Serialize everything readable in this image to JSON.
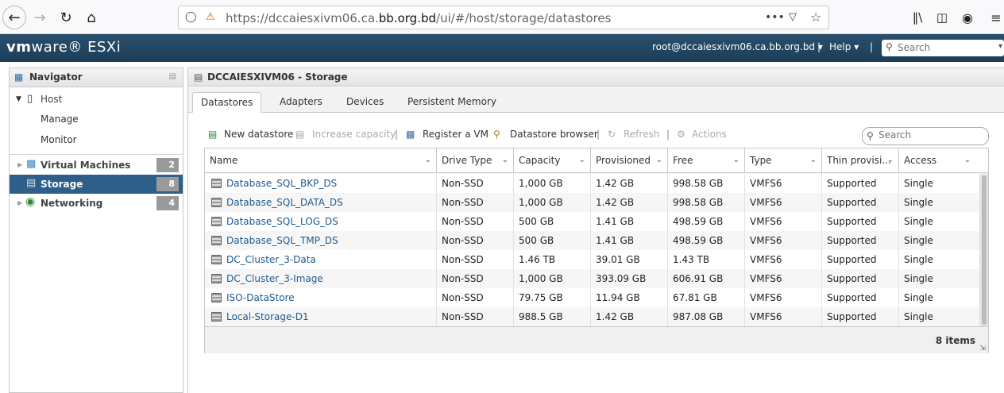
{
  "browser": {
    "url_prefix": "https://dccaiesxivm06.ca.",
    "url_host": "bb.org.bd",
    "url_suffix": "/ui/#/host/storage/datastores"
  },
  "header": {
    "logo_vm": "vm",
    "logo_ware": "ware",
    "logo_product": "ESXi",
    "user": "root@dccaiesxivm06.ca.bb.org.bd",
    "help": "Help",
    "search_placeholder": "Search"
  },
  "navigator": {
    "title": "Navigator",
    "host": "Host",
    "manage": "Manage",
    "monitor": "Monitor",
    "items": [
      {
        "label": "Virtual Machines",
        "count": "2"
      },
      {
        "label": "Storage",
        "count": "8"
      },
      {
        "label": "Networking",
        "count": "4"
      }
    ]
  },
  "main": {
    "title": "DCCAIESXIVM06 - Storage",
    "tabs": [
      "Datastores",
      "Adapters",
      "Devices",
      "Persistent Memory"
    ],
    "toolbar": {
      "new_datastore": "New datastore",
      "increase_capacity": "Increase capacity",
      "register_vm": "Register a VM",
      "datastore_browser": "Datastore browser",
      "refresh": "Refresh",
      "actions": "Actions"
    },
    "search_placeholder": "Search",
    "columns": [
      "Name",
      "Drive Type",
      "Capacity",
      "Provisioned",
      "Free",
      "Type",
      "Thin provisi...",
      "Access"
    ],
    "rows": [
      {
        "name": "Database_SQL_BKP_DS",
        "drive": "Non-SSD",
        "capacity": "1,000 GB",
        "provisioned": "1.42 GB",
        "free": "998.58 GB",
        "type": "VMFS6",
        "thin": "Supported",
        "access": "Single"
      },
      {
        "name": "Database_SQL_DATA_DS",
        "drive": "Non-SSD",
        "capacity": "1,000 GB",
        "provisioned": "1.42 GB",
        "free": "998.58 GB",
        "type": "VMFS6",
        "thin": "Supported",
        "access": "Single"
      },
      {
        "name": "Database_SQL_LOG_DS",
        "drive": "Non-SSD",
        "capacity": "500 GB",
        "provisioned": "1.41 GB",
        "free": "498.59 GB",
        "type": "VMFS6",
        "thin": "Supported",
        "access": "Single"
      },
      {
        "name": "Database_SQL_TMP_DS",
        "drive": "Non-SSD",
        "capacity": "500 GB",
        "provisioned": "1.41 GB",
        "free": "498.59 GB",
        "type": "VMFS6",
        "thin": "Supported",
        "access": "Single"
      },
      {
        "name": "DC_Cluster_3-Data",
        "drive": "Non-SSD",
        "capacity": "1.46 TB",
        "provisioned": "39.01 GB",
        "free": "1.43 TB",
        "type": "VMFS6",
        "thin": "Supported",
        "access": "Single"
      },
      {
        "name": "DC_Cluster_3-Image",
        "drive": "Non-SSD",
        "capacity": "1,000 GB",
        "provisioned": "393.09 GB",
        "free": "606.91 GB",
        "type": "VMFS6",
        "thin": "Supported",
        "access": "Single"
      },
      {
        "name": "ISO-DataStore",
        "drive": "Non-SSD",
        "capacity": "79.75 GB",
        "provisioned": "11.94 GB",
        "free": "67.81 GB",
        "type": "VMFS6",
        "thin": "Supported",
        "access": "Single"
      },
      {
        "name": "Local-Storage-D1",
        "drive": "Non-SSD",
        "capacity": "988.5 GB",
        "provisioned": "1.42 GB",
        "free": "987.08 GB",
        "type": "VMFS6",
        "thin": "Supported",
        "access": "Single"
      }
    ],
    "item_count": "8 items"
  }
}
